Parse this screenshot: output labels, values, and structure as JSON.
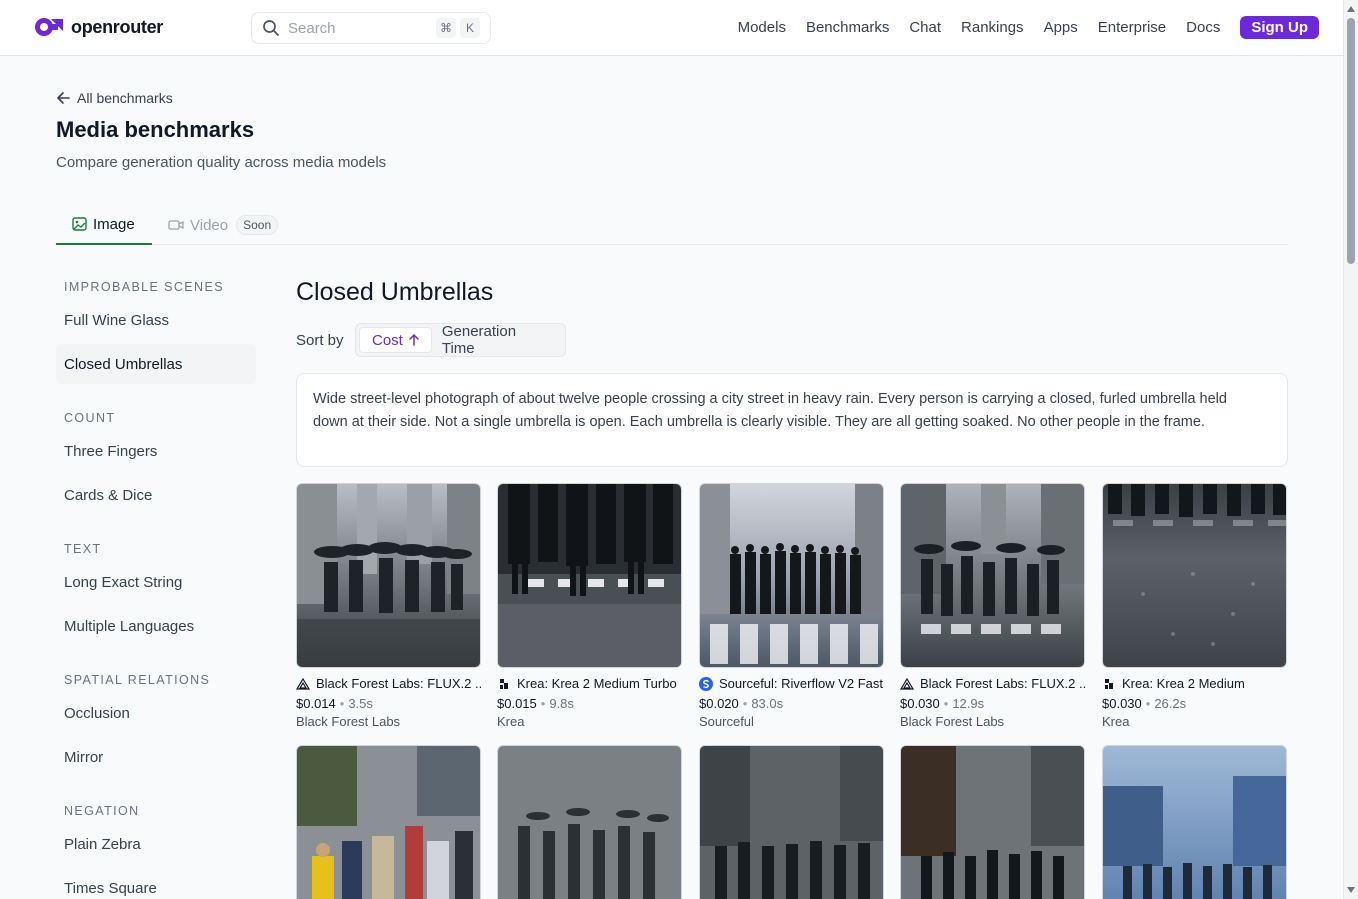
{
  "header": {
    "logo_text": "openrouter",
    "search_placeholder": "Search",
    "kbd_cmd": "⌘",
    "kbd_key": "K",
    "nav": [
      "Models",
      "Benchmarks",
      "Chat",
      "Rankings",
      "Apps",
      "Enterprise",
      "Docs"
    ],
    "signup": "Sign Up",
    "brand_color": "#6d28d9"
  },
  "page": {
    "back_label": "All benchmarks",
    "title": "Media benchmarks",
    "subtitle": "Compare generation quality across media models"
  },
  "tabs": {
    "image": "Image",
    "video": "Video",
    "soon": "Soon"
  },
  "sidebar": {
    "sections": [
      {
        "heading": "IMPROBABLE SCENES",
        "items": [
          "Full Wine Glass",
          "Closed Umbrellas"
        ]
      },
      {
        "heading": "COUNT",
        "items": [
          "Three Fingers",
          "Cards & Dice"
        ]
      },
      {
        "heading": "TEXT",
        "items": [
          "Long Exact String",
          "Multiple Languages"
        ]
      },
      {
        "heading": "SPATIAL RELATIONS",
        "items": [
          "Occlusion",
          "Mirror"
        ]
      },
      {
        "heading": "NEGATION",
        "items": [
          "Plain Zebra",
          "Times Square"
        ]
      }
    ],
    "active": "Closed Umbrellas"
  },
  "main": {
    "title": "Closed Umbrellas",
    "sort_by": "Sort by",
    "sort_cost": "Cost",
    "sort_time": "Generation Time",
    "prompt": "Wide street-level photograph of about twelve people crossing a city street in heavy rain. Every person is carrying a closed, furled umbrella held down at their side. Not a single umbrella is open. Each umbrella is clearly visible. They are all getting soaked. No other people in the frame."
  },
  "results": [
    {
      "model": "Black Forest Labs: FLUX.2 ...",
      "cost": "$0.014",
      "time": "3.5s",
      "provider": "Black Forest Labs",
      "icon": "bfl-triangle-icon"
    },
    {
      "model": "Krea: Krea 2 Medium Turbo",
      "cost": "$0.015",
      "time": "9.8s",
      "provider": "Krea",
      "icon": "krea-icon"
    },
    {
      "model": "Sourceful: Riverflow V2 Fast",
      "cost": "$0.020",
      "time": "83.0s",
      "provider": "Sourceful",
      "icon": "sourceful-icon"
    },
    {
      "model": "Black Forest Labs: FLUX.2 ...",
      "cost": "$0.030",
      "time": "12.9s",
      "provider": "Black Forest Labs",
      "icon": "bfl-triangle-icon"
    },
    {
      "model": "Krea: Krea 2 Medium",
      "cost": "$0.030",
      "time": "26.2s",
      "provider": "Krea",
      "icon": "krea-icon"
    }
  ]
}
